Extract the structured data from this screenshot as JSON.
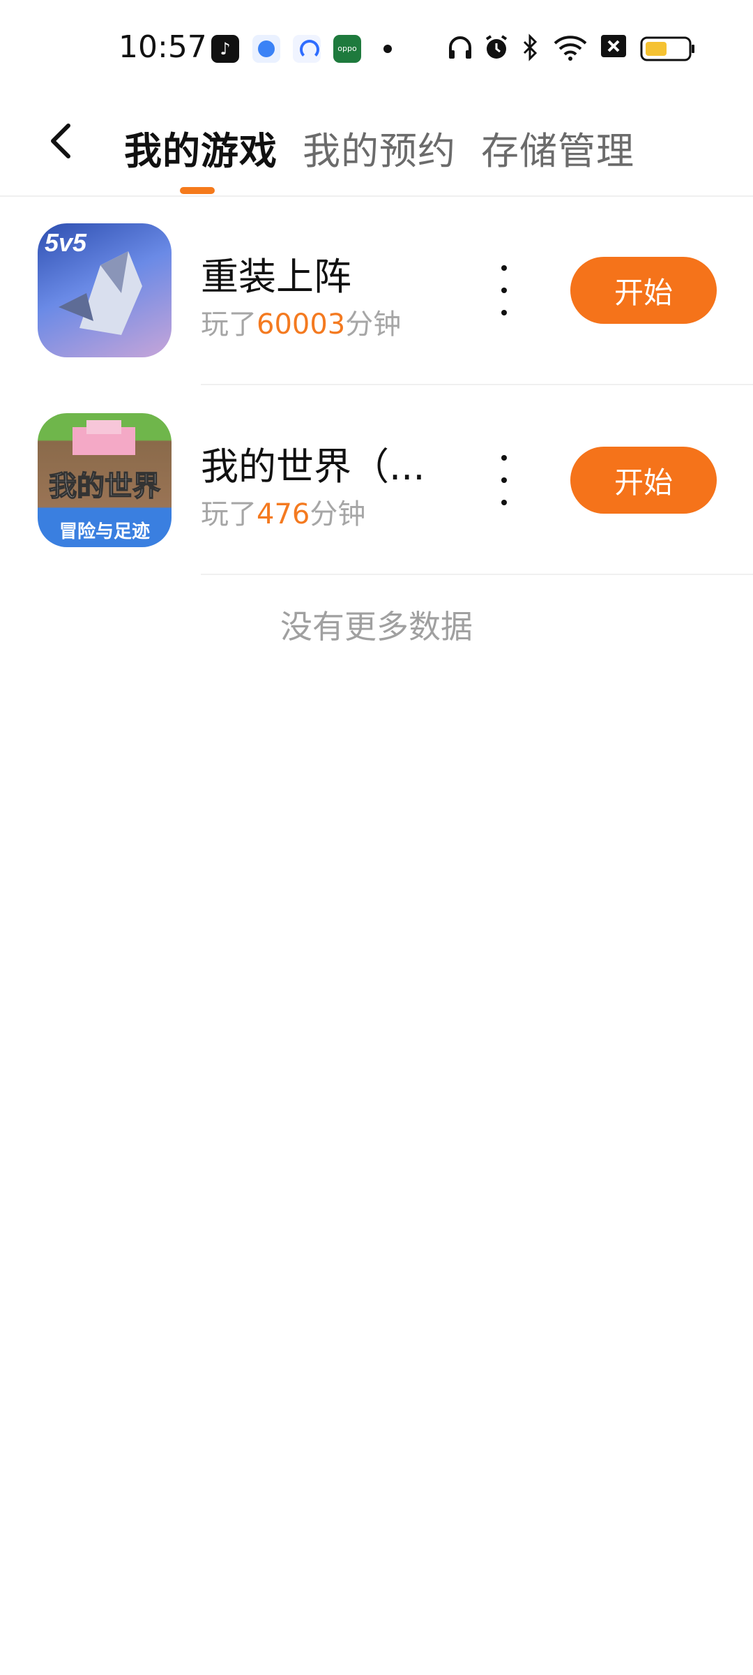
{
  "status_bar": {
    "time": "10:57",
    "apps": [
      "tiktok-icon",
      "blue-app-icon",
      "lock-app-icon",
      "oppo-icon"
    ],
    "right_icons": [
      "headphones-icon",
      "alarm-icon",
      "bluetooth-icon",
      "wifi-icon",
      "sim-off-icon",
      "battery-icon"
    ]
  },
  "header": {
    "tabs": [
      {
        "label": "我的游戏",
        "active": true
      },
      {
        "label": "我的预约",
        "active": false
      },
      {
        "label": "存储管理",
        "active": false
      }
    ]
  },
  "games": [
    {
      "title": "重装上阵",
      "played_prefix": "玩了",
      "played_value": "60003",
      "played_suffix": "分钟",
      "button": "开始",
      "icon_text": "5v5"
    },
    {
      "title": "我的世界（...",
      "played_prefix": "玩了",
      "played_value": "476",
      "played_suffix": "分钟",
      "button": "开始",
      "icon_text": "我的世界",
      "icon_subtext": "冒险与足迹"
    }
  ],
  "footer_text": "没有更多数据",
  "colors": {
    "accent": "#f5731a",
    "played_value": "#f47a20"
  }
}
